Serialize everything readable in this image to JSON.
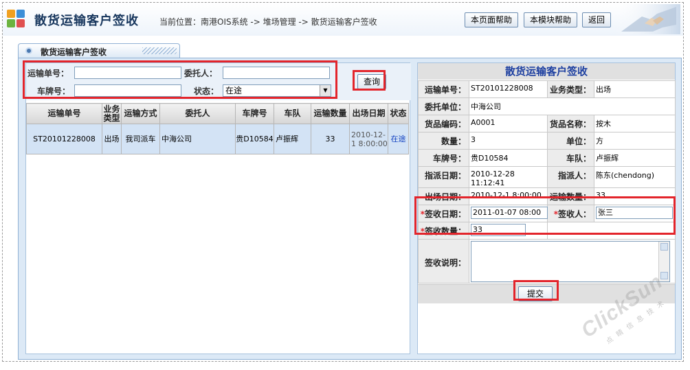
{
  "header": {
    "title": "散货运输客户签收",
    "breadcrumb": "当前位置：南港OIS系统 -> 堆场管理 -> 散货运输客户签收",
    "buttons": [
      "本页面帮助",
      "本模块帮助",
      "返回"
    ]
  },
  "tab": {
    "label": "散货运输客户签收"
  },
  "search": {
    "transport_no_label": "运输单号：",
    "transport_no_value": "",
    "consignor_label": "委托人：",
    "consignor_value": "",
    "plate_label": "车牌号：",
    "plate_value": "",
    "status_label": "状态：",
    "status_value": "在途",
    "query_label": "查询"
  },
  "grid": {
    "columns": [
      "运输单号",
      "业务类型",
      "运输方式",
      "委托人",
      "车牌号",
      "车队",
      "运输数量",
      "出场日期",
      "状态"
    ],
    "rows": [
      {
        "transport_no": "ST20101228008",
        "biz_type": "出场",
        "transport_mode": "我司派车",
        "consignor": "中海公司",
        "plate": "贵D10584",
        "fleet": "卢振辉",
        "quantity": "33",
        "exit_date": "2010-12-1 8:00:00",
        "status": "在途"
      }
    ]
  },
  "form": {
    "title": "散货运输客户签收",
    "transport_no_label": "运输单号：",
    "transport_no": "ST20101228008",
    "biz_type_label": "业务类型：",
    "biz_type": "出场",
    "client_label": "委托单位：",
    "client": "中海公司",
    "goods_code_label": "货品编码：",
    "goods_code": "A0001",
    "goods_name_label": "货品名称：",
    "goods_name": "按木",
    "count_label": "数量：",
    "count": "3",
    "unit_label": "单位：",
    "unit": "方",
    "plate_label": "车牌号：",
    "plate": "贵D10584",
    "fleet_label": "车队：",
    "fleet": "卢振辉",
    "dispatch_date_label": "指派日期：",
    "dispatch_date": "2010-12-28 11:12:41",
    "dispatcher_label": "指派人：",
    "dispatcher": "陈东(chendong)",
    "exit_date_label": "出场日期：",
    "exit_date": "2010-12-1 8:00:00",
    "transport_qty_label": "运输数量：",
    "transport_qty": "33",
    "sign_date_label": "签收日期：",
    "sign_date": "2011-01-07 08:00",
    "signer_label": "签收人：",
    "signer": "张三",
    "sign_qty_label": "签收数量：",
    "sign_qty": "33",
    "sign_note_label": "签收说明：",
    "sign_note": "",
    "required_mark": "*",
    "submit_label": "提交"
  },
  "watermark": {
    "brand": "ClickSun",
    "sub": "点睛信息技术"
  },
  "colors": {
    "highlight": "#e3242b",
    "panel_bg": "#dce9f6",
    "form_title": "#1d3fa0"
  }
}
